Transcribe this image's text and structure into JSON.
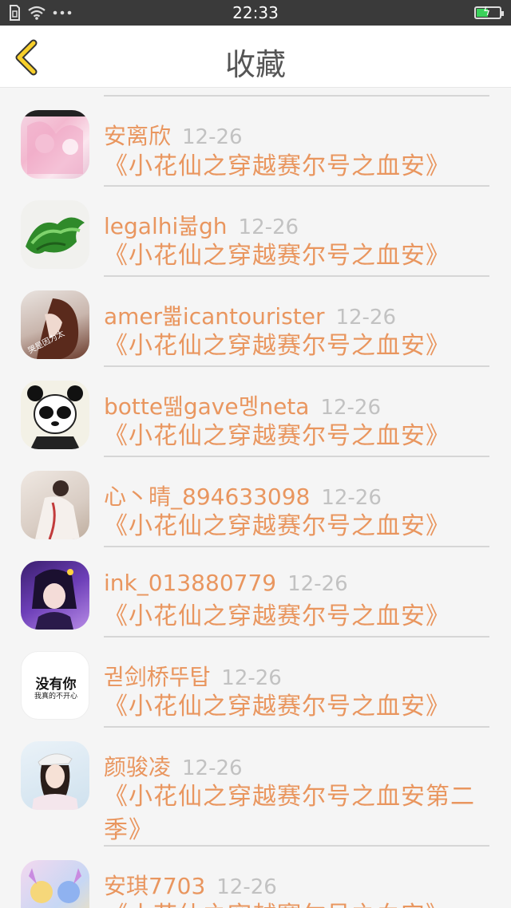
{
  "status_bar": {
    "time": "22:33",
    "icons": [
      "sim-icon",
      "wifi-icon",
      "more-dots-icon",
      "battery-charging-icon"
    ],
    "battery_level": 0.5
  },
  "header": {
    "title": "收藏",
    "back_icon": "chevron-left-icon"
  },
  "colors": {
    "accent": "#e9965f",
    "date": "#c2c2c2",
    "back_arrow": "#f2c200"
  },
  "items": [
    {
      "name": "安离欣",
      "date": "12-26",
      "work": "《小花仙之穿越赛尔号之血安》"
    },
    {
      "name": "legalhi붋gh",
      "date": "12-26",
      "work": "《小花仙之穿越赛尔号之血安》"
    },
    {
      "name": "amer뿗icantourister",
      "date": "12-26",
      "work": "《小花仙之穿越赛尔号之血安》"
    },
    {
      "name": "botte뗆gave멩neta",
      "date": "12-26",
      "work": "《小花仙之穿越赛尔号之血安》"
    },
    {
      "name": "心丶晴_894633098",
      "date": "12-26",
      "work": "《小花仙之穿越赛尔号之血安》"
    },
    {
      "name": "ink_013880779",
      "date": "12-26",
      "work": "《小花仙之穿越赛尔号之血安》"
    },
    {
      "name": "궏剑桥뚜탑",
      "date": "12-26",
      "work": "《小花仙之穿越赛尔号之血安》",
      "avatar_text_1": "没有你",
      "avatar_text_2": "我真的不开心"
    },
    {
      "name": "颜骏凌",
      "date": "12-26",
      "work": "《小花仙之穿越赛尔号之血安第二季》"
    },
    {
      "name": "安琪7703",
      "date": "12-26",
      "work": "《小花仙之穿越赛尔号之血安》"
    }
  ]
}
